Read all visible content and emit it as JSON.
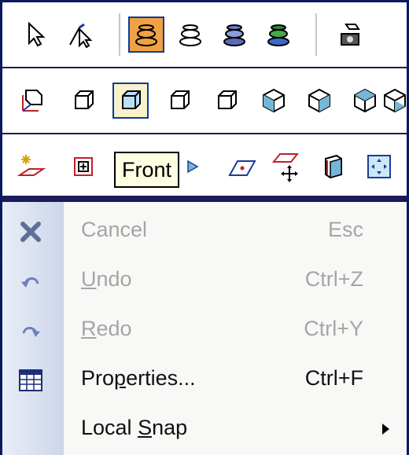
{
  "tooltip": {
    "text": "Front"
  },
  "toolbar1": {
    "icons": [
      "select-arrow-icon",
      "select-edge-icon",
      "render-teapot-icon",
      "wireframe-teapot-icon",
      "shaded-teapot-icon",
      "textured-teapot-icon",
      "camera-icon"
    ],
    "active": "render-teapot-icon"
  },
  "toolbar2": {
    "icons": [
      "view-axis-cube-icon",
      "view-top-cube-icon",
      "view-front-cube-icon",
      "view-right-cube-icon",
      "view-back-cube-icon",
      "view-iso1-cube-icon",
      "view-iso2-cube-icon",
      "view-iso3-cube-icon",
      "view-iso4-cube-icon"
    ],
    "selected": "view-front-cube-icon"
  },
  "toolbar3": {
    "icons": [
      "plane-star-icon",
      "zoom-box-icon",
      "view-prev-icon",
      "plane-edge-icon",
      "plane-move-icon",
      "view-section-icon",
      "zoom-extents-icon"
    ]
  },
  "menu": {
    "items": [
      {
        "label": "Cancel",
        "shortcut": "Esc",
        "enabled": false,
        "icon": "cancel-x-icon"
      },
      {
        "label": "Undo",
        "mnemonic": "U",
        "shortcut": "Ctrl+Z",
        "enabled": false,
        "icon": "undo-arrow-icon"
      },
      {
        "label": "Redo",
        "mnemonic": "R",
        "shortcut": "Ctrl+Y",
        "enabled": false,
        "icon": "redo-arrow-icon"
      },
      {
        "label": "Properties...",
        "mnemonic": "p",
        "shortcut": "Ctrl+F",
        "enabled": true,
        "icon": "properties-grid-icon"
      },
      {
        "label": "Local Snap",
        "mnemonic": "S",
        "shortcut": "",
        "enabled": true,
        "icon": "",
        "submenu": true
      }
    ]
  },
  "colors": {
    "accent_orange": "#f0a142",
    "frame_navy": "#0a1a5c",
    "tooltip_bg": "#ffffe1",
    "disabled_text": "#a5a5a5"
  }
}
